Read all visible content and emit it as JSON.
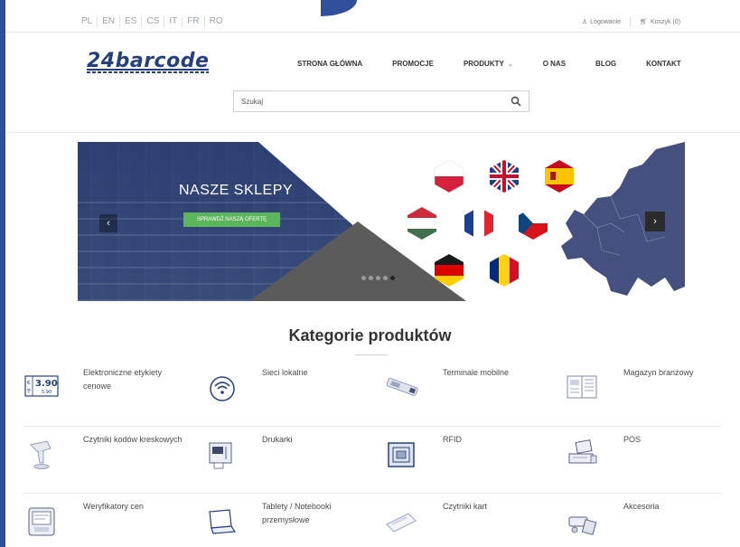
{
  "colors": {
    "frame": "#2f4f9a",
    "brand": "#26407f",
    "button": "#5bb55b"
  },
  "languages": [
    "PL",
    "EN",
    "ES",
    "CS",
    "IT",
    "FR",
    "RO"
  ],
  "account": {
    "login": "Logowanie",
    "cart": "Koszyk (0)",
    "login_icon": "user-icon",
    "cart_icon": "cart-icon"
  },
  "logo": {
    "text": "24barcode"
  },
  "nav": [
    {
      "label": "STRONA GŁÓWNA"
    },
    {
      "label": "PROMOCJE"
    },
    {
      "label": "PRODUKTY"
    },
    {
      "label": "O NAS"
    },
    {
      "label": "BLOG"
    },
    {
      "label": "KONTAKT"
    }
  ],
  "search": {
    "placeholder": "Szukaj",
    "icon": "search-icon"
  },
  "banner": {
    "title": "NASZE SKLEPY",
    "button": "SPRAWDŹ NASZĄ OFERTĘ",
    "prev": "‹",
    "next": "›",
    "slides": 5,
    "active_slide": 5,
    "flags": [
      "poland",
      "united-kingdom",
      "spain",
      "hungary",
      "france",
      "czech-republic",
      "germany",
      "romania"
    ]
  },
  "categories": {
    "title": "Kategorie produktów",
    "items": [
      {
        "label": "Elektroniczne etykiety cenowe",
        "icon": "price-label-icon"
      },
      {
        "label": "Sieci lokalne",
        "icon": "wifi-icon"
      },
      {
        "label": "Terminale mobilne",
        "icon": "mobile-terminal-icon"
      },
      {
        "label": "Magazyn branżowy",
        "icon": "magazine-icon"
      },
      {
        "label": "Czytniki kodów kreskowych",
        "icon": "barcode-scanner-icon"
      },
      {
        "label": "Drukarki",
        "icon": "printer-icon"
      },
      {
        "label": "RFID",
        "icon": "rfid-icon"
      },
      {
        "label": "POS",
        "icon": "pos-icon"
      },
      {
        "label": "Weryfikatory cen",
        "icon": "price-checker-icon"
      },
      {
        "label": "Tablety / Notebooki przemysłowe",
        "icon": "laptop-icon"
      },
      {
        "label": "Czytniki kart",
        "icon": "card-reader-icon"
      },
      {
        "label": "Akcesoria",
        "icon": "accessories-icon"
      }
    ],
    "price_icon_text": {
      "main": "3.90",
      "sub": "5.90"
    }
  }
}
